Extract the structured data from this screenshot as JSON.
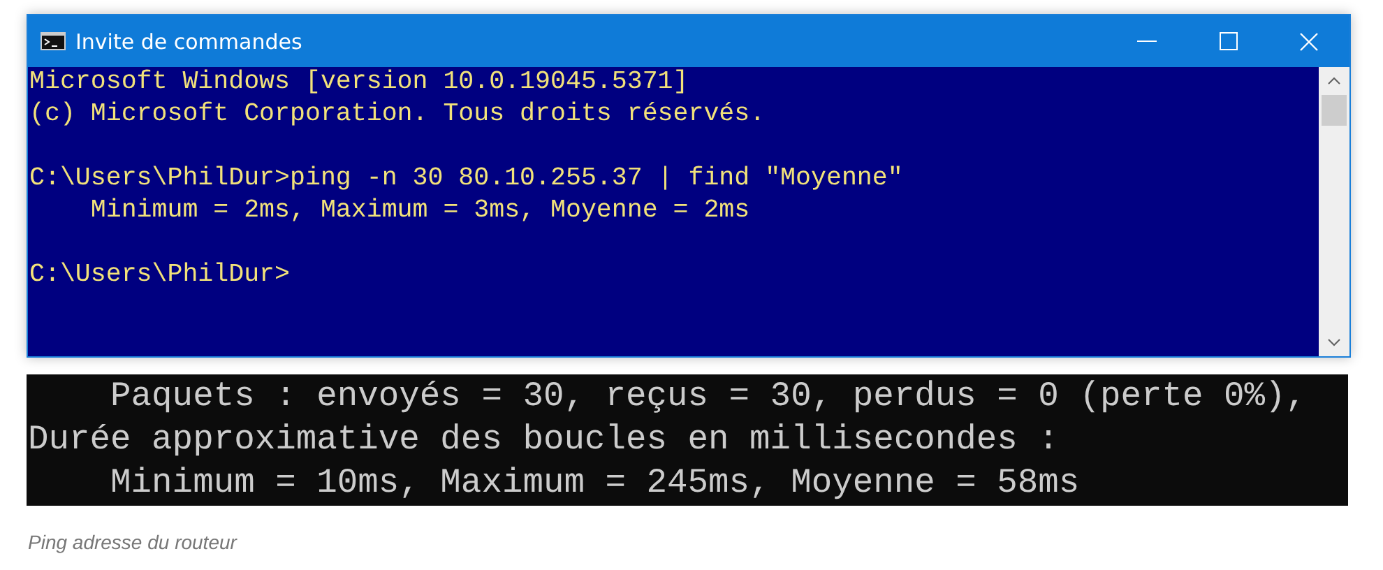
{
  "window": {
    "title": "Invite de commandes"
  },
  "console": {
    "blocks": [
      [
        "Microsoft Windows [version 10.0.19045.5371]",
        "(c) Microsoft Corporation. Tous droits réservés."
      ],
      [
        "C:\\Users\\PhilDur>ping -n 30 80.10.255.37 | find \"Moyenne\"",
        "    Minimum = 2ms, Maximum = 3ms, Moyenne = 2ms"
      ],
      [
        "C:\\Users\\PhilDur>"
      ]
    ]
  },
  "output_panel": {
    "lines": [
      "    Paquets : envoyés = 30, reçus = 30, perdus = 0 (perte 0%),",
      "Durée approximative des boucles en millisecondes :",
      "    Minimum = 10ms, Maximum = 245ms, Moyenne = 58ms"
    ]
  },
  "caption": "Ping adresse du routeur"
}
